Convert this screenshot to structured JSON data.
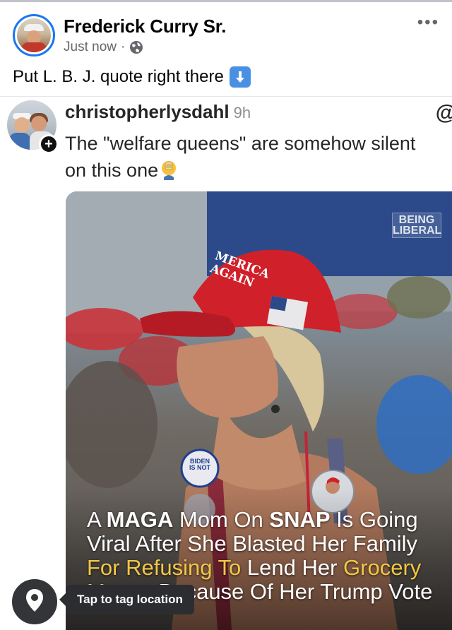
{
  "post": {
    "author": "Frederick Curry Sr.",
    "time": "Just now",
    "separator": "·",
    "privacy_icon": "globe-icon",
    "caption": "Put L. B. J. quote right there",
    "caption_emoji_icon": "down-arrow-emoji-icon",
    "more_label": "•••"
  },
  "shared": {
    "username": "christopherlysdahl",
    "time_ago": "9h",
    "threads_icon_label": "@",
    "text": "The \"welfare queens\" are somehow silent on this one",
    "emoji_icon": "face-palm-emoji-icon",
    "plus_label": "+"
  },
  "photo": {
    "watermark_line1": "BEING",
    "watermark_line2": "LIBERAL",
    "hat_text_line1": "MERICA",
    "hat_text_line2": "AGAIN",
    "button_text_line1": "BIDEN",
    "button_text_line2": "IS NOT",
    "headline": {
      "p1": "A ",
      "p2": "MAGA",
      "p3": " Mom On ",
      "p4": "SNAP",
      "p5": " Is Going Viral After She Blasted Her Family ",
      "p6": "For Refusing To",
      "p7": " Lend Her ",
      "p8": "Grocery Money",
      "p9": " Because Of Her Trump Vote"
    }
  },
  "location": {
    "tooltip": "Tap to tag location",
    "icon": "location-pin-icon"
  },
  "colors": {
    "accent": "#1877f2",
    "hat_red": "#d0202a",
    "headline_yellow": "#f2c744"
  }
}
